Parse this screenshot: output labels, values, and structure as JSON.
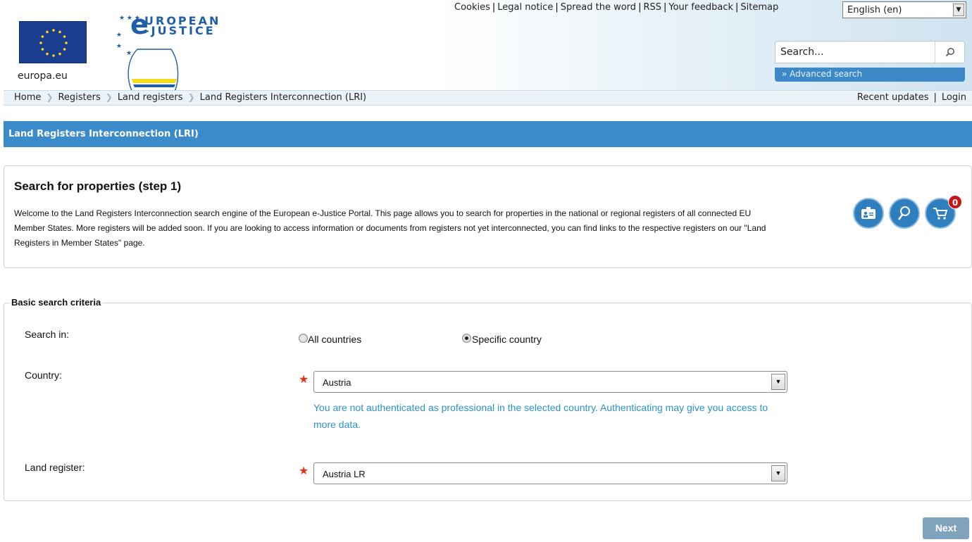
{
  "header": {
    "europa_label": "europa.eu",
    "logo": {
      "line1": "UROPEAN",
      "line2": "-JUSTICE"
    },
    "top_links": [
      "Cookies",
      "Legal notice",
      "Spread the word",
      "RSS",
      "Your feedback",
      "Sitemap"
    ],
    "language": {
      "selected": "English (en)"
    },
    "search": {
      "placeholder": "Search...",
      "advanced_label": "» Advanced search"
    }
  },
  "breadcrumb": [
    "Home",
    "Registers",
    "Land registers",
    "Land Registers Interconnection (LRI)"
  ],
  "top_right": {
    "recent_updates": "Recent updates",
    "login": "Login",
    "separator": "|"
  },
  "title_bar": {
    "title": "Land Registers Interconnection (LRI)"
  },
  "intro": {
    "heading": "Search for properties (step 1)",
    "text": "Welcome to the Land Registers Interconnection search engine of the European e-Justice Portal. This page allows you to search for properties in the national or regional registers of all connected EU Member States. More registers will be added soon. If you are looking to access information or documents from registers not yet interconnected, you can find links to the respective registers on our \"Land Registers in Member States\" page.",
    "cart_count": "0",
    "icons": [
      "id-card-icon",
      "search-icon",
      "cart-icon"
    ]
  },
  "criteria": {
    "legend": "Basic search criteria",
    "search_in": {
      "label": "Search in:",
      "options": [
        "All countries",
        "Specific country"
      ],
      "selected": "Specific country"
    },
    "country": {
      "label": "Country:",
      "value": "Austria"
    },
    "auth_message": "You are not authenticated as professional in the selected country. Authenticating may give you access to more data.",
    "land_register": {
      "label": "Land register:",
      "value": "Austria LR"
    }
  },
  "actions": {
    "next": "Next"
  },
  "colors": {
    "title_bar": "#3b8bcb",
    "link_info": "#2a94c7",
    "required": "#e4321b",
    "next_button": "#7fa3bd"
  }
}
